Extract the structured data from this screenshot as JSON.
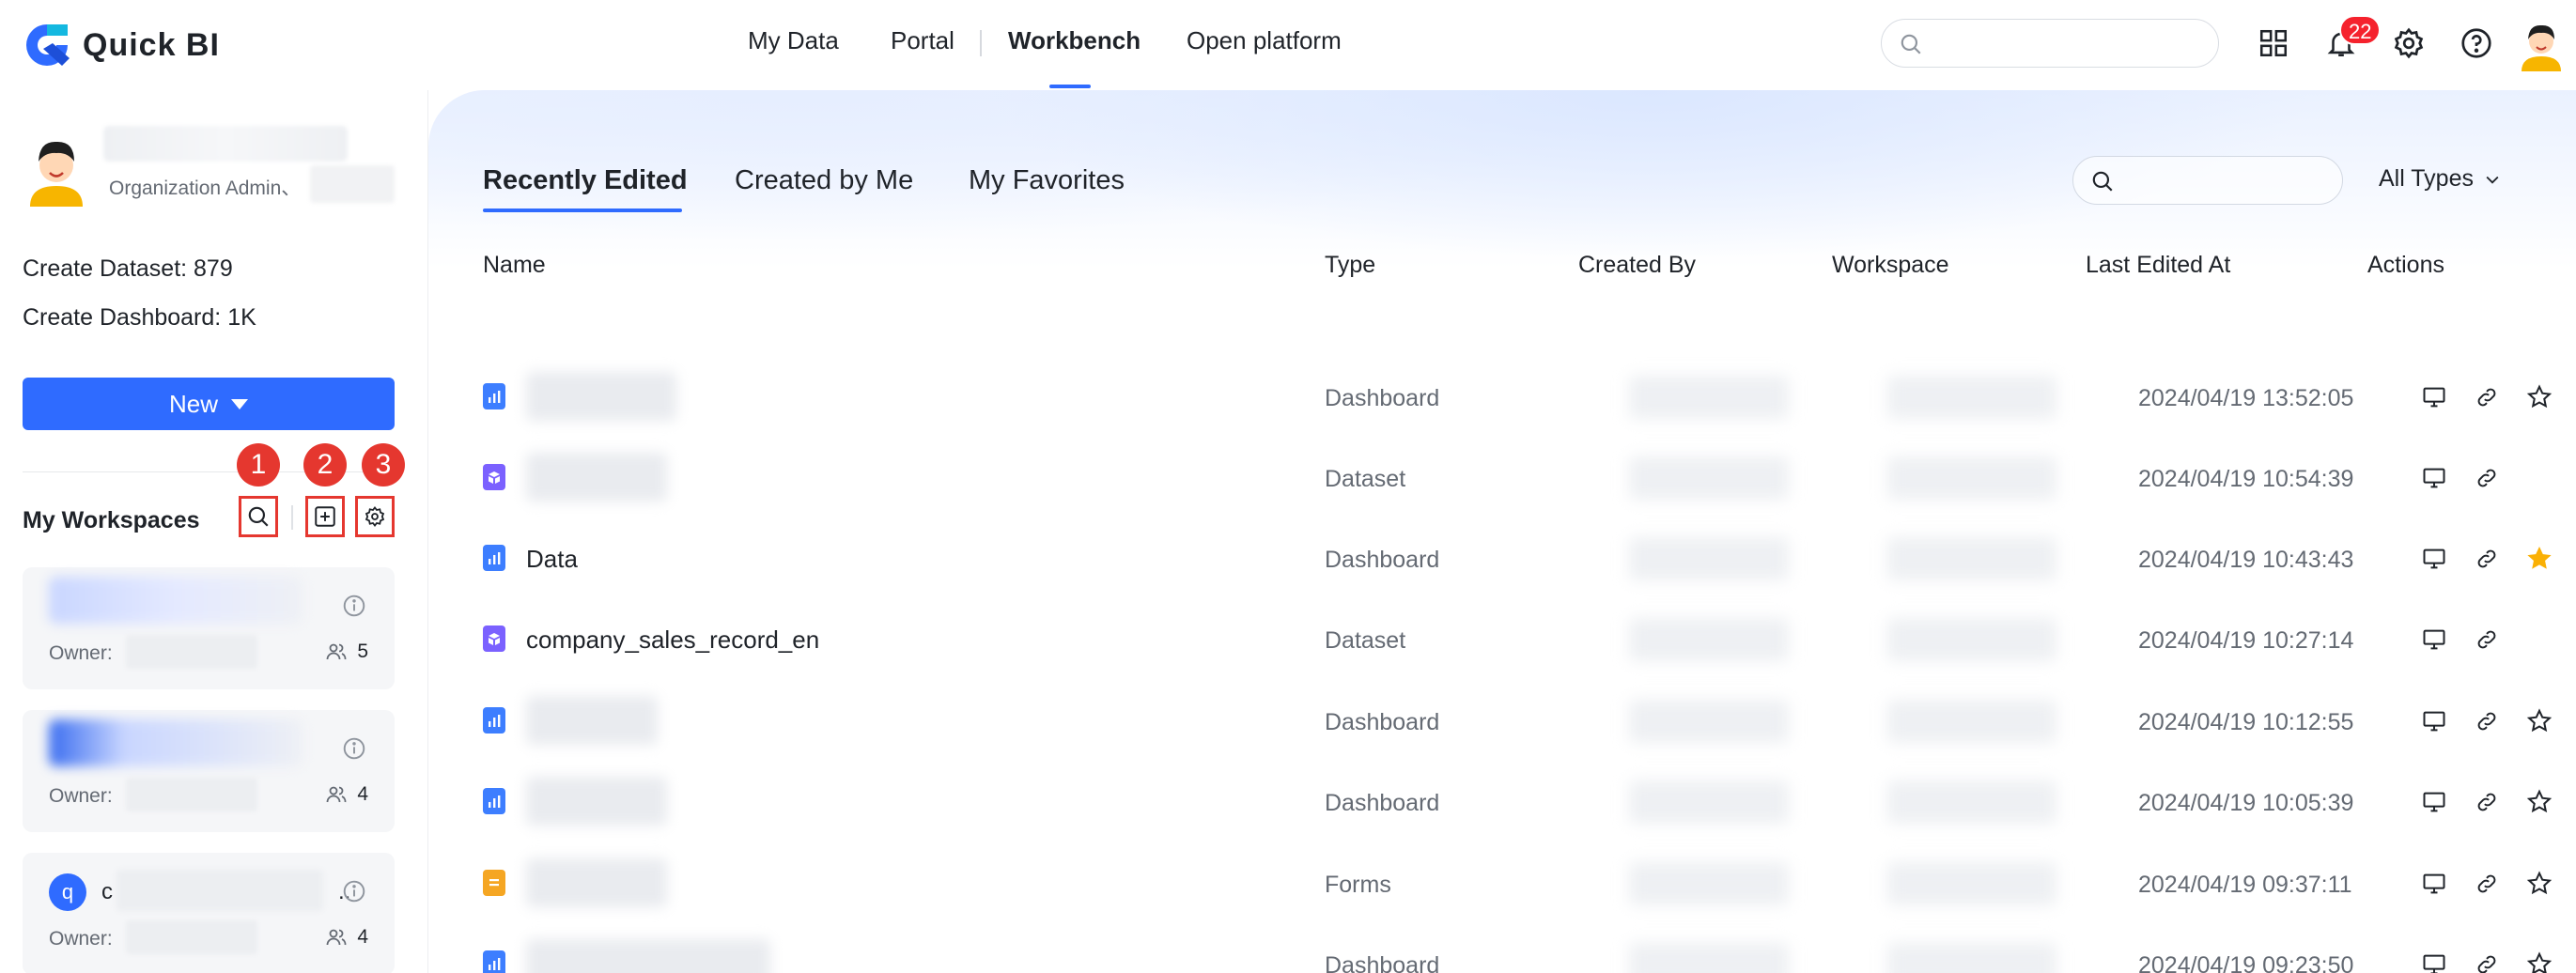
{
  "app": {
    "name": "Quick BI",
    "brand_color": "#2f6bff"
  },
  "nav": {
    "items": [
      "My Data",
      "Portal",
      "Workbench",
      "Open platform"
    ],
    "active": "Workbench"
  },
  "header": {
    "search_placeholder": "",
    "notification_count": "22"
  },
  "user": {
    "role": "Organization Admin、"
  },
  "stats": {
    "dataset_label": "Create Dataset: ",
    "dataset_value": "879",
    "dashboard_label": "Create Dashboard: ",
    "dashboard_value": "1K"
  },
  "new_button": "New",
  "workspaces": {
    "title": "My Workspaces",
    "markers": [
      "1",
      "2",
      "3"
    ],
    "cards": [
      {
        "letter": "",
        "name": "",
        "owner_label": "Owner:",
        "members": "5"
      },
      {
        "letter": "",
        "name": "",
        "owner_label": "Owner:",
        "members": "4"
      },
      {
        "letter": "q",
        "name": "c",
        "suffix": "..",
        "owner_label": "Owner:",
        "members": "4"
      }
    ]
  },
  "tabs": [
    "Recently Edited",
    "Created by Me",
    "My Favorites"
  ],
  "active_tab": "Recently Edited",
  "main_search_placeholder": "",
  "type_filter": "All Types",
  "table": {
    "columns": [
      "Name",
      "Type",
      "Created By",
      "Workspace",
      "Last Edited At",
      "Actions"
    ],
    "rows": [
      {
        "icon": "dashboard-icon",
        "name": "",
        "type": "Dashboard",
        "edited": "2024/04/19 13:52:05",
        "favorite": false
      },
      {
        "icon": "dataset-icon",
        "name": "",
        "type": "Dataset",
        "edited": "2024/04/19 10:54:39",
        "favorite": null
      },
      {
        "icon": "dashboard-icon",
        "name": "Data",
        "type": "Dashboard",
        "edited": "2024/04/19 10:43:43",
        "favorite": true
      },
      {
        "icon": "dataset-icon",
        "name": "company_sales_record_en",
        "type": "Dataset",
        "edited": "2024/04/19 10:27:14",
        "favorite": null
      },
      {
        "icon": "dashboard-icon",
        "name": "",
        "type": "Dashboard",
        "edited": "2024/04/19 10:12:55",
        "favorite": false
      },
      {
        "icon": "dashboard-icon",
        "name": "",
        "type": "Dashboard",
        "edited": "2024/04/19 10:05:39",
        "favorite": false
      },
      {
        "icon": "forms-icon",
        "name": "",
        "type": "Forms",
        "edited": "2024/04/19 09:37:11",
        "favorite": false
      },
      {
        "icon": "dashboard-icon",
        "name": "",
        "type": "Dashboard",
        "edited": "2024/04/19 09:23:50",
        "favorite": false
      }
    ]
  },
  "colors": {
    "accent": "#2f6bff",
    "marker": "#e5372f",
    "star": "#fab005",
    "dashboard_icon": "#3d7eff",
    "dataset_icon": "#7b61ff",
    "forms_icon": "#f5a623"
  }
}
